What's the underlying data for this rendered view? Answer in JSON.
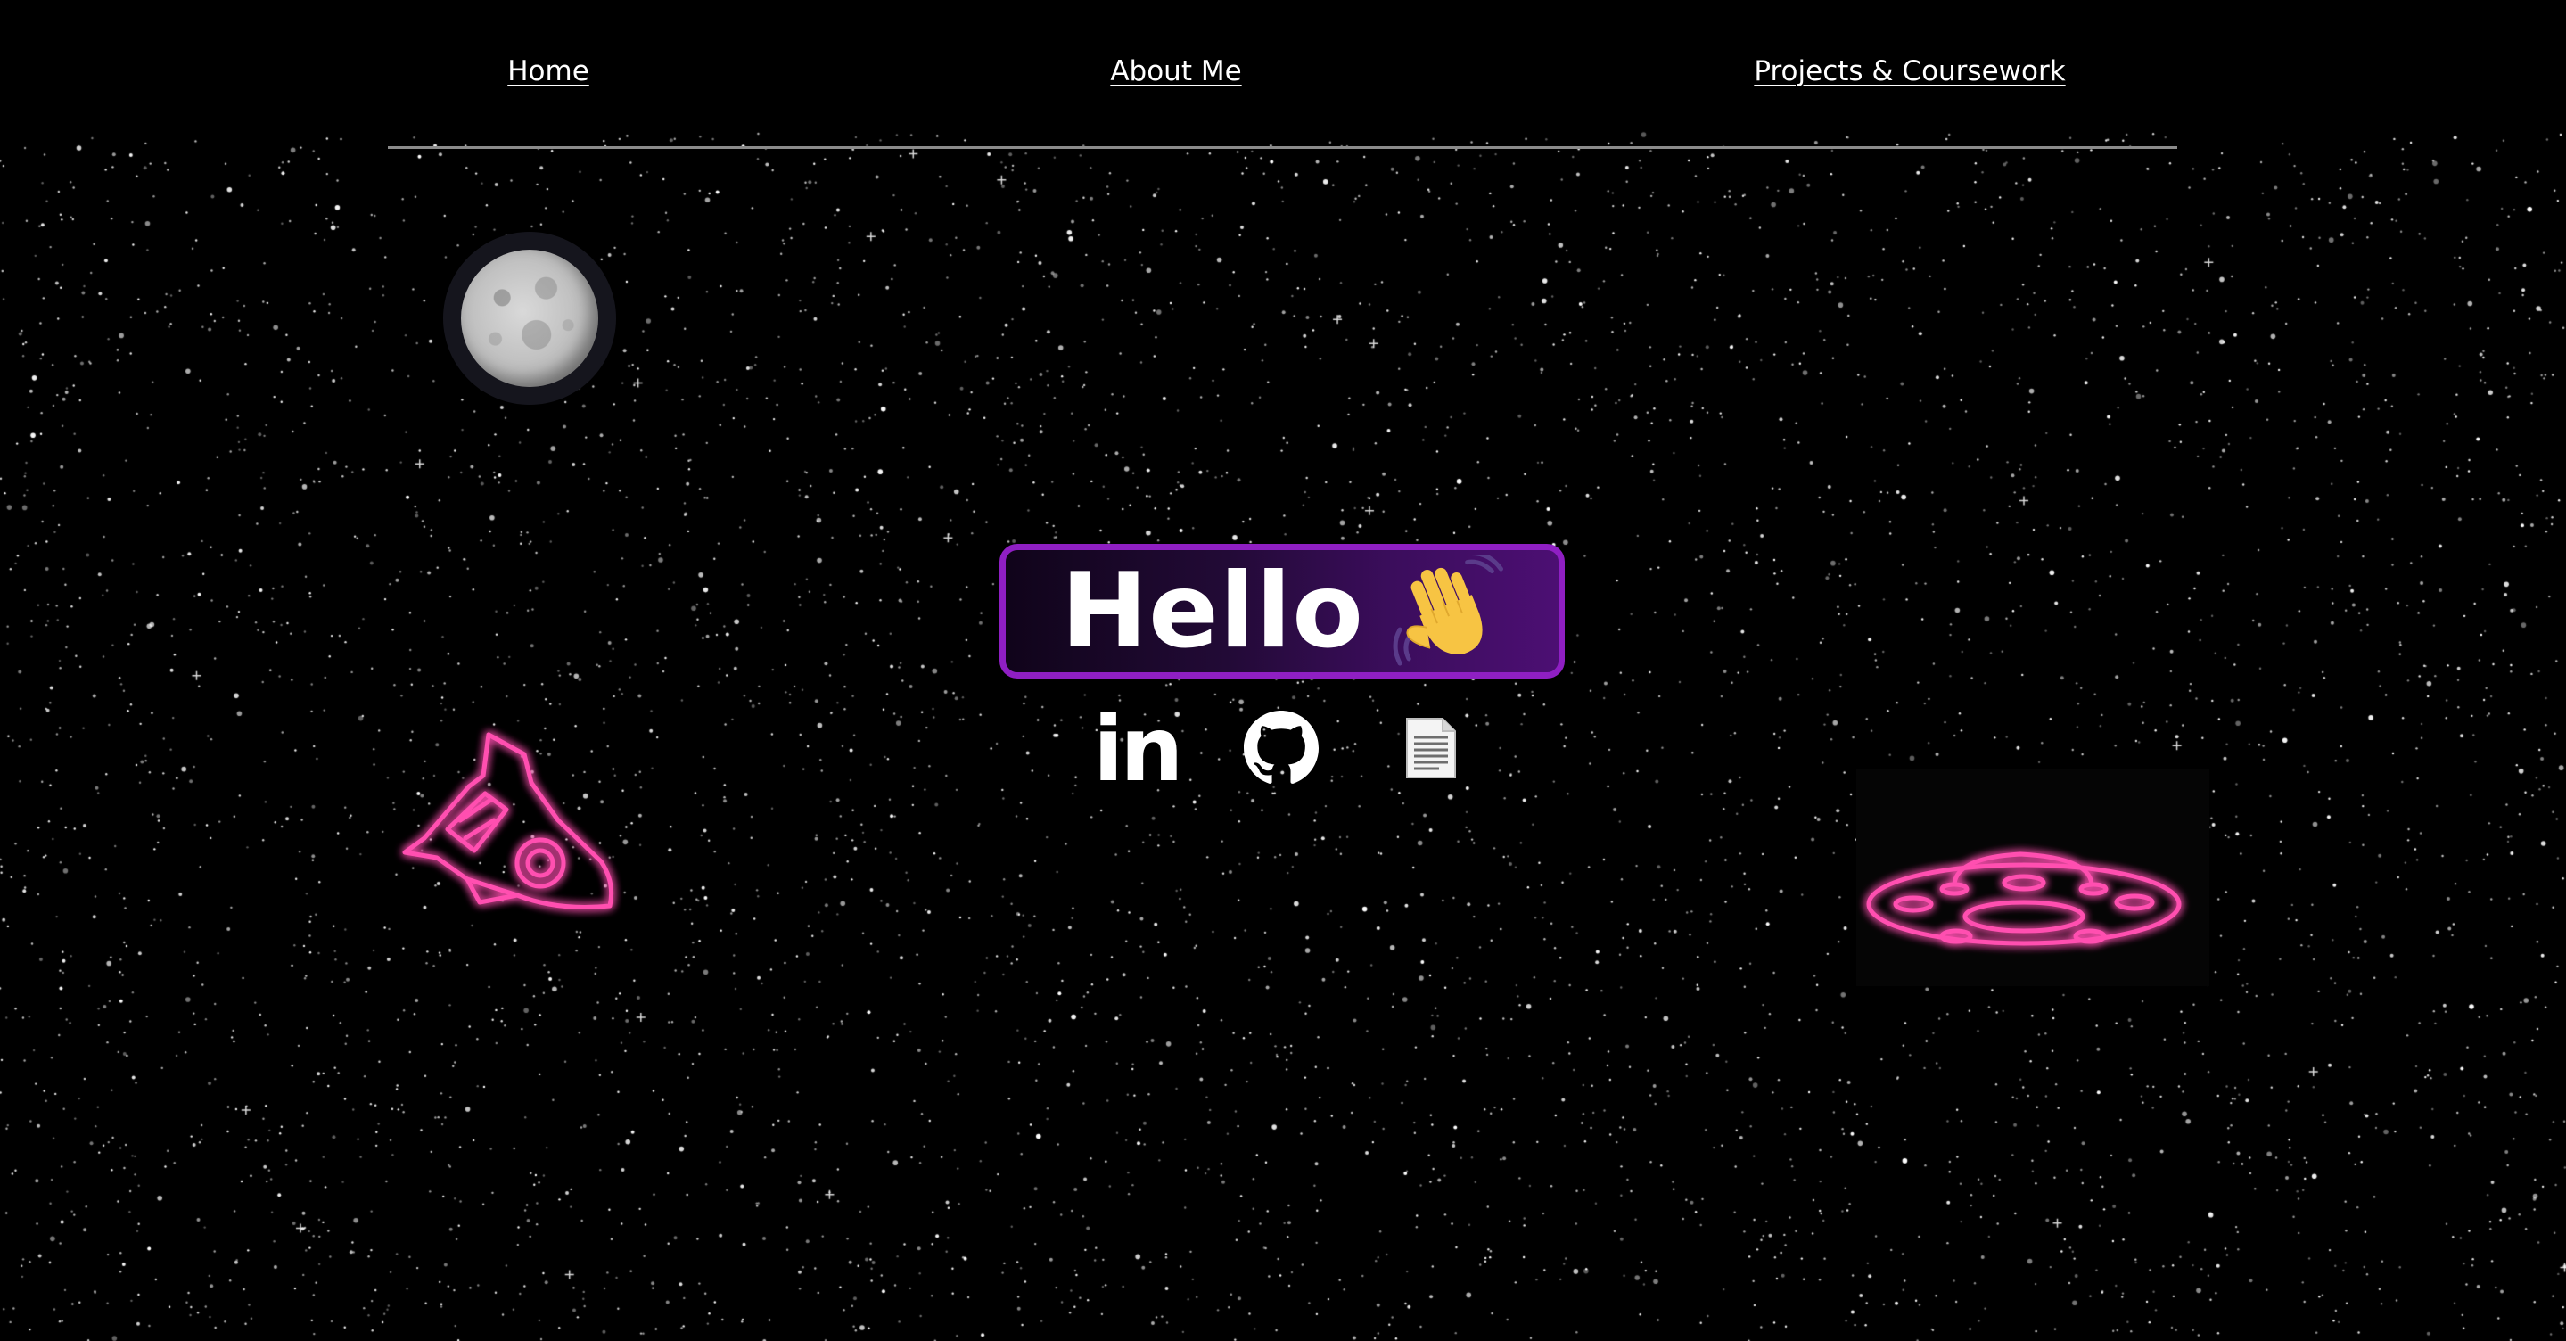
{
  "nav": {
    "items": [
      {
        "label": "Home"
      },
      {
        "label": "About Me"
      },
      {
        "label": "Projects & Coursework"
      }
    ]
  },
  "hero": {
    "greeting": "Hello",
    "greeting_icon": "waving-hand-icon"
  },
  "social": {
    "linkedin": {
      "icon": "linkedin-icon",
      "label": "in"
    },
    "github": {
      "icon": "github-icon"
    },
    "resume": {
      "icon": "document-icon"
    }
  },
  "decorations": [
    "moon",
    "neon-rocket",
    "neon-ufo",
    "starfield"
  ],
  "colors": {
    "background": "#000000",
    "badge_border": "#8f1fc3",
    "badge_fill": "#3b0d5c",
    "neon_pink": "#ff4fb0",
    "text": "#ffffff",
    "divider": "#8b8b8b"
  }
}
